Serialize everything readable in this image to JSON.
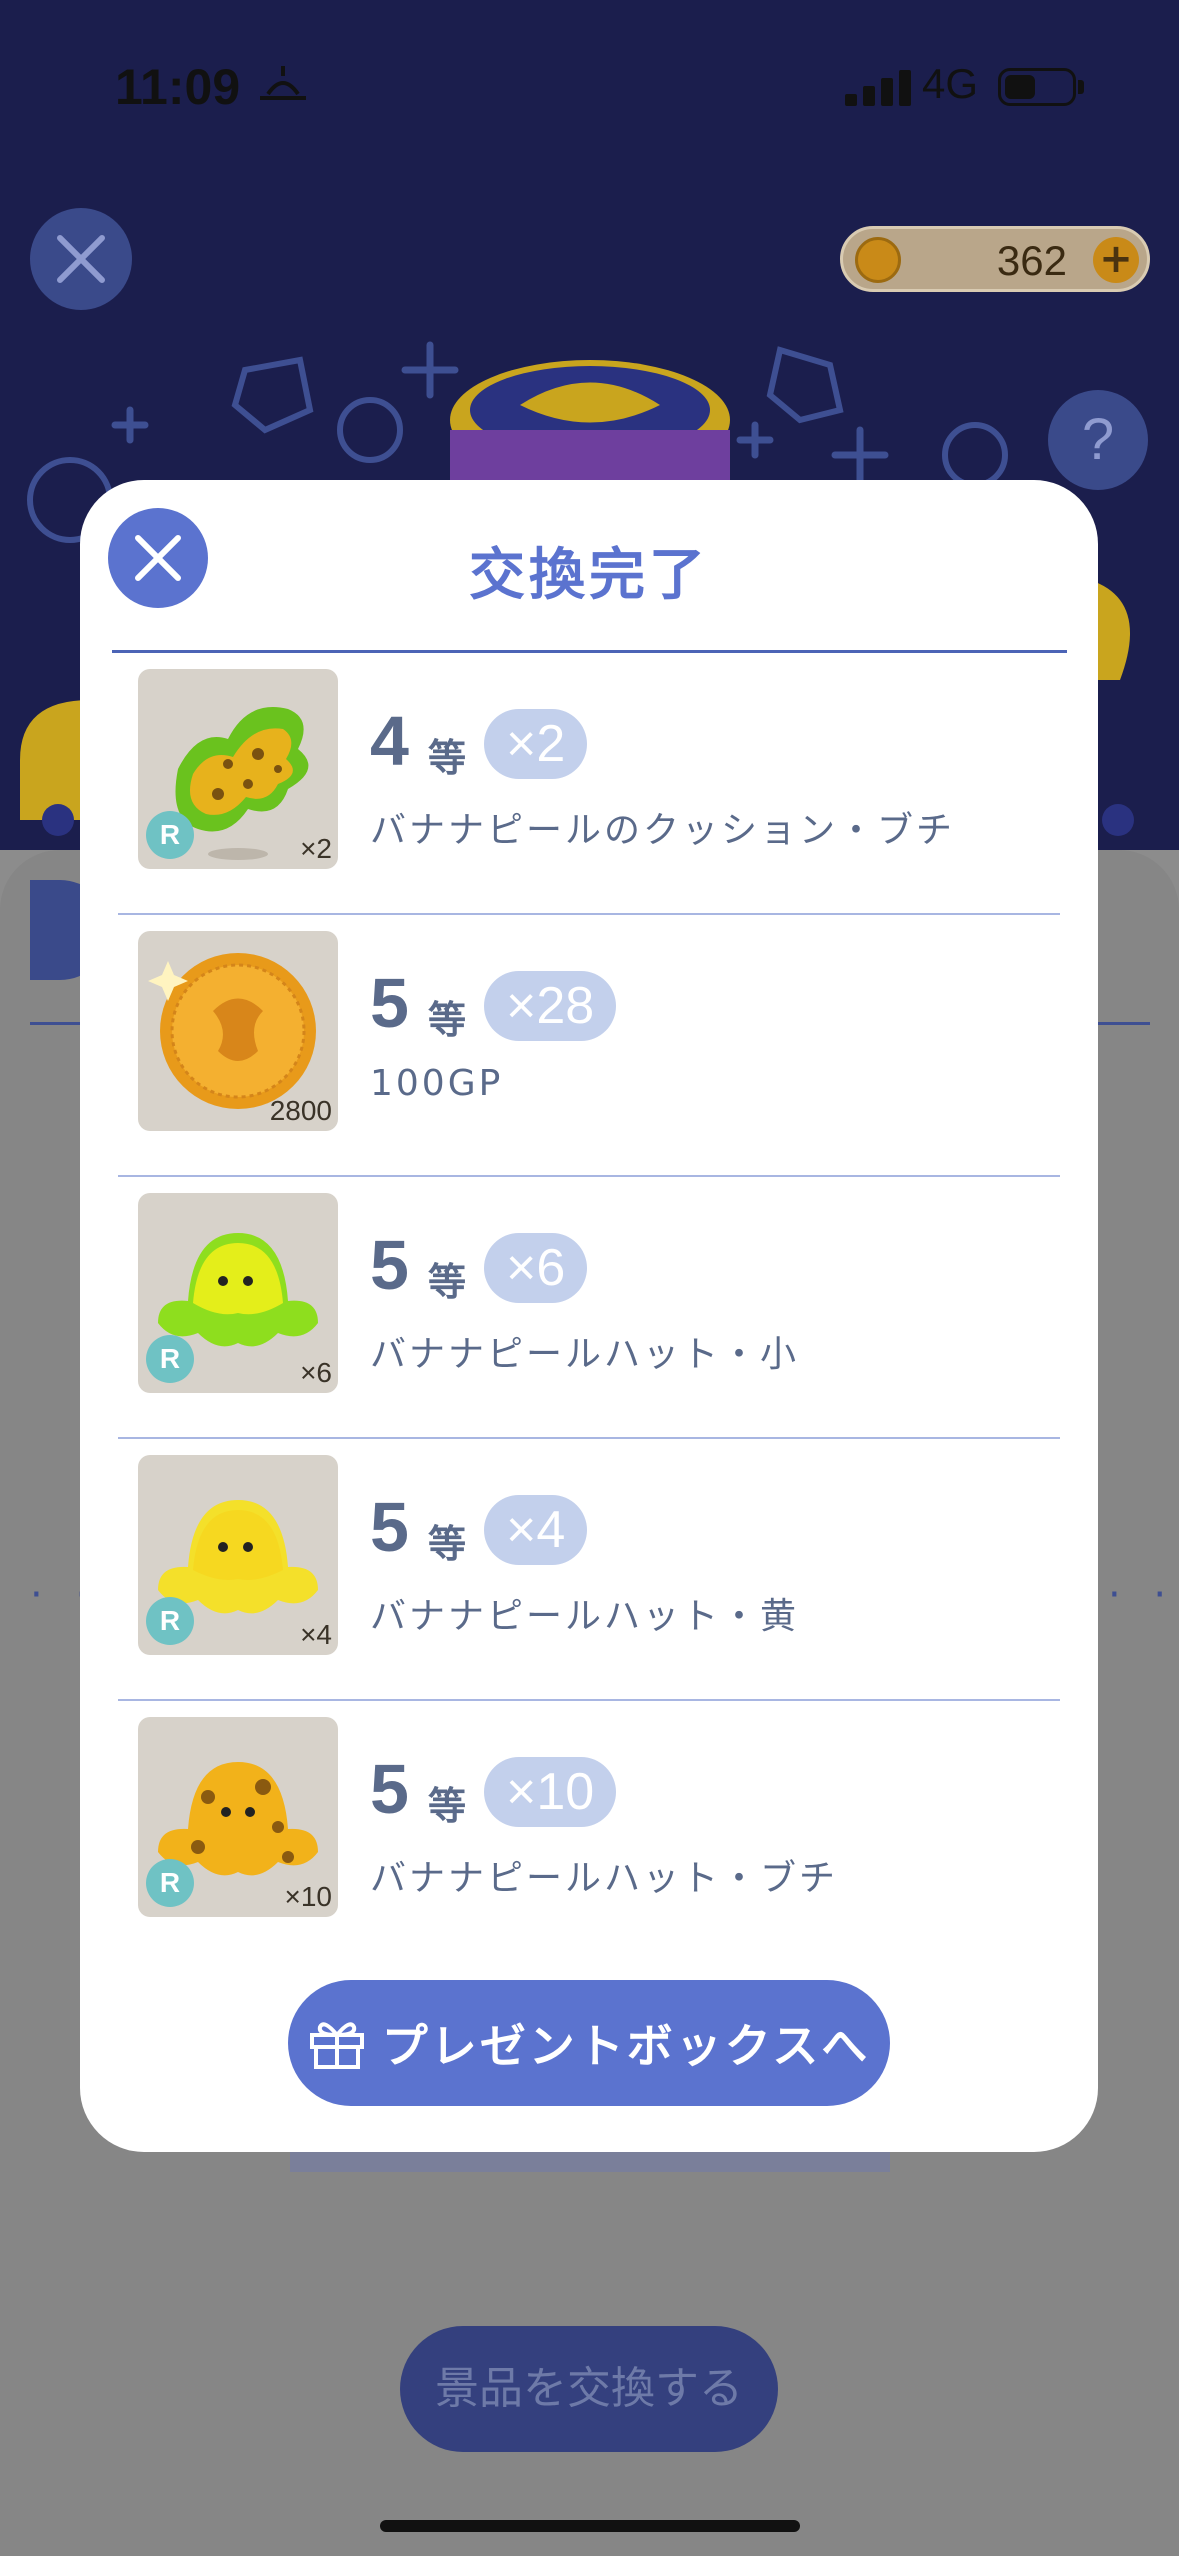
{
  "status_bar": {
    "time": "11:09",
    "network": "4G"
  },
  "header": {
    "coins": "362",
    "coin_plus": "+",
    "help": "?"
  },
  "modal": {
    "title": "交換完了",
    "items": [
      {
        "rank": "4",
        "rank_suffix": "等",
        "count": "×2",
        "name": "バナナピールのクッション・ブチ",
        "thumb_label": "×2",
        "rarity": "R",
        "icon": "banana-peel-cushion-icon"
      },
      {
        "rank": "5",
        "rank_suffix": "等",
        "count": "×28",
        "name": "100GP",
        "thumb_label": "2800",
        "rarity": "",
        "icon": "gold-coin-icon"
      },
      {
        "rank": "5",
        "rank_suffix": "等",
        "count": "×6",
        "name": "バナナピールハット・小",
        "thumb_label": "×6",
        "rarity": "R",
        "icon": "banana-hat-small-icon"
      },
      {
        "rank": "5",
        "rank_suffix": "等",
        "count": "×4",
        "name": "バナナピールハット・黄",
        "thumb_label": "×4",
        "rarity": "R",
        "icon": "banana-hat-yellow-icon"
      },
      {
        "rank": "5",
        "rank_suffix": "等",
        "count": "×10",
        "name": "バナナピールハット・ブチ",
        "thumb_label": "×10",
        "rarity": "R",
        "icon": "banana-hat-spotted-icon"
      }
    ],
    "present_button": "プレゼントボックスへ"
  },
  "background": {
    "exchange_button": "景品を交換する"
  },
  "colors": {
    "accent": "#5b73cf",
    "pill": "#c3d0ec",
    "text": "#5a6a8a"
  }
}
